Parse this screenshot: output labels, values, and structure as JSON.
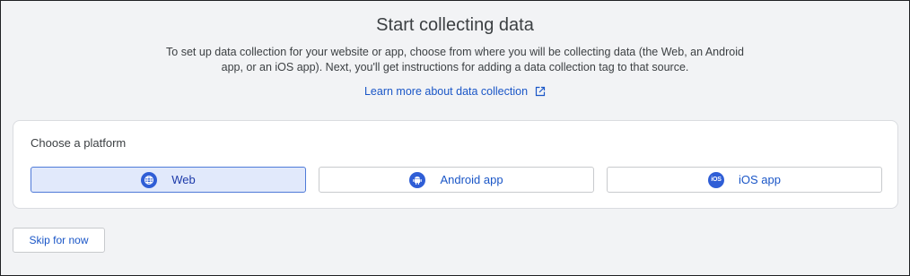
{
  "header": {
    "title": "Start collecting data",
    "description_lines": [
      "To set up data collection for your website or app, choose from where you will be collecting data (the Web, an Android",
      "app, or an iOS app). Next, you'll get instructions for adding a data collection tag to that source."
    ],
    "learn_more_label": "Learn more about data collection"
  },
  "platform_card": {
    "title": "Choose a platform",
    "options": [
      {
        "label": "Web",
        "icon": "globe-icon",
        "selected": true
      },
      {
        "label": "Android app",
        "icon": "android-icon",
        "selected": false
      },
      {
        "label": "iOS app",
        "icon": "ios-icon",
        "icon_text": "iOS",
        "selected": false
      }
    ]
  },
  "footer": {
    "skip_label": "Skip for now"
  },
  "colors": {
    "accent": "#1a56c7",
    "icon_bg": "#2f5ed6",
    "selected_bg": "#e1e9fb",
    "page_bg": "#f2f3f5"
  }
}
